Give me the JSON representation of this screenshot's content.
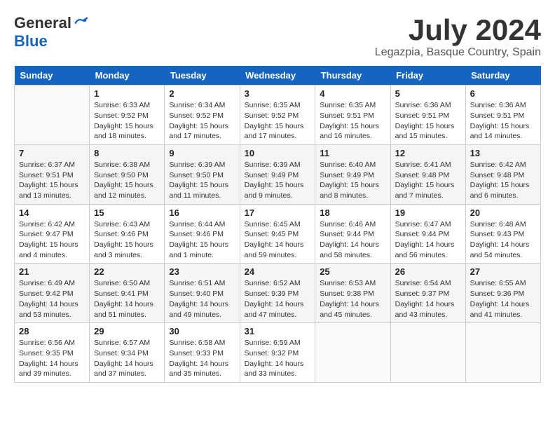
{
  "header": {
    "logo_general": "General",
    "logo_blue": "Blue",
    "month_title": "July 2024",
    "location": "Legazpia, Basque Country, Spain"
  },
  "weekdays": [
    "Sunday",
    "Monday",
    "Tuesday",
    "Wednesday",
    "Thursday",
    "Friday",
    "Saturday"
  ],
  "weeks": [
    [
      {
        "day": "",
        "info": ""
      },
      {
        "day": "1",
        "info": "Sunrise: 6:33 AM\nSunset: 9:52 PM\nDaylight: 15 hours\nand 18 minutes."
      },
      {
        "day": "2",
        "info": "Sunrise: 6:34 AM\nSunset: 9:52 PM\nDaylight: 15 hours\nand 17 minutes."
      },
      {
        "day": "3",
        "info": "Sunrise: 6:35 AM\nSunset: 9:52 PM\nDaylight: 15 hours\nand 17 minutes."
      },
      {
        "day": "4",
        "info": "Sunrise: 6:35 AM\nSunset: 9:51 PM\nDaylight: 15 hours\nand 16 minutes."
      },
      {
        "day": "5",
        "info": "Sunrise: 6:36 AM\nSunset: 9:51 PM\nDaylight: 15 hours\nand 15 minutes."
      },
      {
        "day": "6",
        "info": "Sunrise: 6:36 AM\nSunset: 9:51 PM\nDaylight: 15 hours\nand 14 minutes."
      }
    ],
    [
      {
        "day": "7",
        "info": "Sunrise: 6:37 AM\nSunset: 9:51 PM\nDaylight: 15 hours\nand 13 minutes."
      },
      {
        "day": "8",
        "info": "Sunrise: 6:38 AM\nSunset: 9:50 PM\nDaylight: 15 hours\nand 12 minutes."
      },
      {
        "day": "9",
        "info": "Sunrise: 6:39 AM\nSunset: 9:50 PM\nDaylight: 15 hours\nand 11 minutes."
      },
      {
        "day": "10",
        "info": "Sunrise: 6:39 AM\nSunset: 9:49 PM\nDaylight: 15 hours\nand 9 minutes."
      },
      {
        "day": "11",
        "info": "Sunrise: 6:40 AM\nSunset: 9:49 PM\nDaylight: 15 hours\nand 8 minutes."
      },
      {
        "day": "12",
        "info": "Sunrise: 6:41 AM\nSunset: 9:48 PM\nDaylight: 15 hours\nand 7 minutes."
      },
      {
        "day": "13",
        "info": "Sunrise: 6:42 AM\nSunset: 9:48 PM\nDaylight: 15 hours\nand 6 minutes."
      }
    ],
    [
      {
        "day": "14",
        "info": "Sunrise: 6:42 AM\nSunset: 9:47 PM\nDaylight: 15 hours\nand 4 minutes."
      },
      {
        "day": "15",
        "info": "Sunrise: 6:43 AM\nSunset: 9:46 PM\nDaylight: 15 hours\nand 3 minutes."
      },
      {
        "day": "16",
        "info": "Sunrise: 6:44 AM\nSunset: 9:46 PM\nDaylight: 15 hours\nand 1 minute."
      },
      {
        "day": "17",
        "info": "Sunrise: 6:45 AM\nSunset: 9:45 PM\nDaylight: 14 hours\nand 59 minutes."
      },
      {
        "day": "18",
        "info": "Sunrise: 6:46 AM\nSunset: 9:44 PM\nDaylight: 14 hours\nand 58 minutes."
      },
      {
        "day": "19",
        "info": "Sunrise: 6:47 AM\nSunset: 9:44 PM\nDaylight: 14 hours\nand 56 minutes."
      },
      {
        "day": "20",
        "info": "Sunrise: 6:48 AM\nSunset: 9:43 PM\nDaylight: 14 hours\nand 54 minutes."
      }
    ],
    [
      {
        "day": "21",
        "info": "Sunrise: 6:49 AM\nSunset: 9:42 PM\nDaylight: 14 hours\nand 53 minutes."
      },
      {
        "day": "22",
        "info": "Sunrise: 6:50 AM\nSunset: 9:41 PM\nDaylight: 14 hours\nand 51 minutes."
      },
      {
        "day": "23",
        "info": "Sunrise: 6:51 AM\nSunset: 9:40 PM\nDaylight: 14 hours\nand 49 minutes."
      },
      {
        "day": "24",
        "info": "Sunrise: 6:52 AM\nSunset: 9:39 PM\nDaylight: 14 hours\nand 47 minutes."
      },
      {
        "day": "25",
        "info": "Sunrise: 6:53 AM\nSunset: 9:38 PM\nDaylight: 14 hours\nand 45 minutes."
      },
      {
        "day": "26",
        "info": "Sunrise: 6:54 AM\nSunset: 9:37 PM\nDaylight: 14 hours\nand 43 minutes."
      },
      {
        "day": "27",
        "info": "Sunrise: 6:55 AM\nSunset: 9:36 PM\nDaylight: 14 hours\nand 41 minutes."
      }
    ],
    [
      {
        "day": "28",
        "info": "Sunrise: 6:56 AM\nSunset: 9:35 PM\nDaylight: 14 hours\nand 39 minutes."
      },
      {
        "day": "29",
        "info": "Sunrise: 6:57 AM\nSunset: 9:34 PM\nDaylight: 14 hours\nand 37 minutes."
      },
      {
        "day": "30",
        "info": "Sunrise: 6:58 AM\nSunset: 9:33 PM\nDaylight: 14 hours\nand 35 minutes."
      },
      {
        "day": "31",
        "info": "Sunrise: 6:59 AM\nSunset: 9:32 PM\nDaylight: 14 hours\nand 33 minutes."
      },
      {
        "day": "",
        "info": ""
      },
      {
        "day": "",
        "info": ""
      },
      {
        "day": "",
        "info": ""
      }
    ]
  ]
}
